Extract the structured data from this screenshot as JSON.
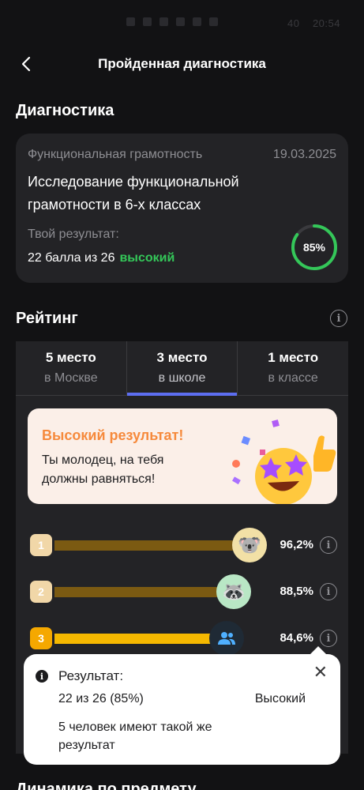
{
  "status_bar": {
    "time": "20:54",
    "battery": "40"
  },
  "appbar": {
    "title": "Пройденная диагностика"
  },
  "diagnostics": {
    "section_title": "Диагностика",
    "category": "Функциональная грамотность",
    "date": "19.03.2025",
    "name": "Исследование функциональной грамотности в 6-х классах",
    "result_label": "Твой результат:",
    "score_text": "22 балла из 26",
    "level": "высокий",
    "percent_label": "85%",
    "percent_value": 0.85,
    "ring_color": "#34c759"
  },
  "rating": {
    "section_title": "Рейтинг",
    "tabs": [
      {
        "place": "5 место",
        "scope": "в Москве",
        "active": false
      },
      {
        "place": "3 место",
        "scope": "в школе",
        "active": true
      },
      {
        "place": "1 место",
        "scope": "в классе",
        "active": false
      }
    ],
    "banner": {
      "title": "Высокий результат!",
      "text": "Ты молодец, на тебя должны равняться!"
    },
    "leaderboard": [
      {
        "rank": "1",
        "percent": "96,2%",
        "fill": 0.962,
        "avatar": "koala-icon",
        "glyph": "🐨"
      },
      {
        "rank": "2",
        "percent": "88,5%",
        "fill": 0.885,
        "avatar": "raccoon-icon",
        "glyph": "🦝"
      },
      {
        "rank": "3",
        "percent": "84,6%",
        "fill": 0.846,
        "avatar": "people-icon",
        "glyph": ""
      }
    ]
  },
  "popup": {
    "title": "Результат:",
    "value": "22 из 26 (85%)",
    "level": "Высокий",
    "note": "5 человек имеют такой же результат"
  },
  "next_section": {
    "title": "Динамика по предмету"
  },
  "colors": {
    "accent": "#5d6ef0",
    "success": "#34c759",
    "bar_dim": "#7b5a12",
    "bar_active": "#f5b800",
    "rank_badge_dim": "#f1d7a8",
    "rank_badge_active": "#f5a800"
  }
}
